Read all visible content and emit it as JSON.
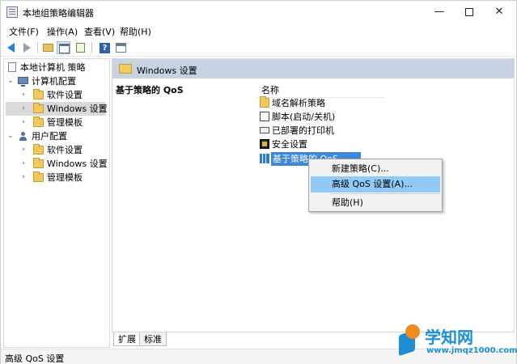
{
  "window": {
    "title": "本地组策略编辑器"
  },
  "menu": {
    "items": [
      "文件(F)",
      "操作(A)",
      "查看(V)",
      "帮助(H)"
    ]
  },
  "tree": {
    "root": "本地计算机 策略",
    "computer_config": "计算机配置",
    "computer_children": [
      "软件设置",
      "Windows 设置",
      "管理模板"
    ],
    "user_config": "用户配置",
    "user_children": [
      "软件设置",
      "Windows 设置",
      "管理模板"
    ]
  },
  "right": {
    "header_title": "Windows 设置",
    "description_title": "基于策略的 QoS",
    "column_name": "名称",
    "items": [
      {
        "label": "域名解析策略",
        "icon": "folder-icon"
      },
      {
        "label": "脚本(启动/关机)",
        "icon": "script-icon"
      },
      {
        "label": "已部署的打印机",
        "icon": "printer-icon"
      },
      {
        "label": "安全设置",
        "icon": "security-icon"
      },
      {
        "label": "基于策略的 QoS",
        "icon": "qos-icon"
      }
    ]
  },
  "tabs": [
    "扩展",
    "标准"
  ],
  "context_menu": {
    "items": [
      "新建策略(C)...",
      "高级 QoS 设置(A)...",
      "帮助(H)"
    ]
  },
  "status": {
    "text": "高级 QoS 设置"
  },
  "watermark": {
    "title": "学知网",
    "url": "www.jmqz1000.com"
  }
}
